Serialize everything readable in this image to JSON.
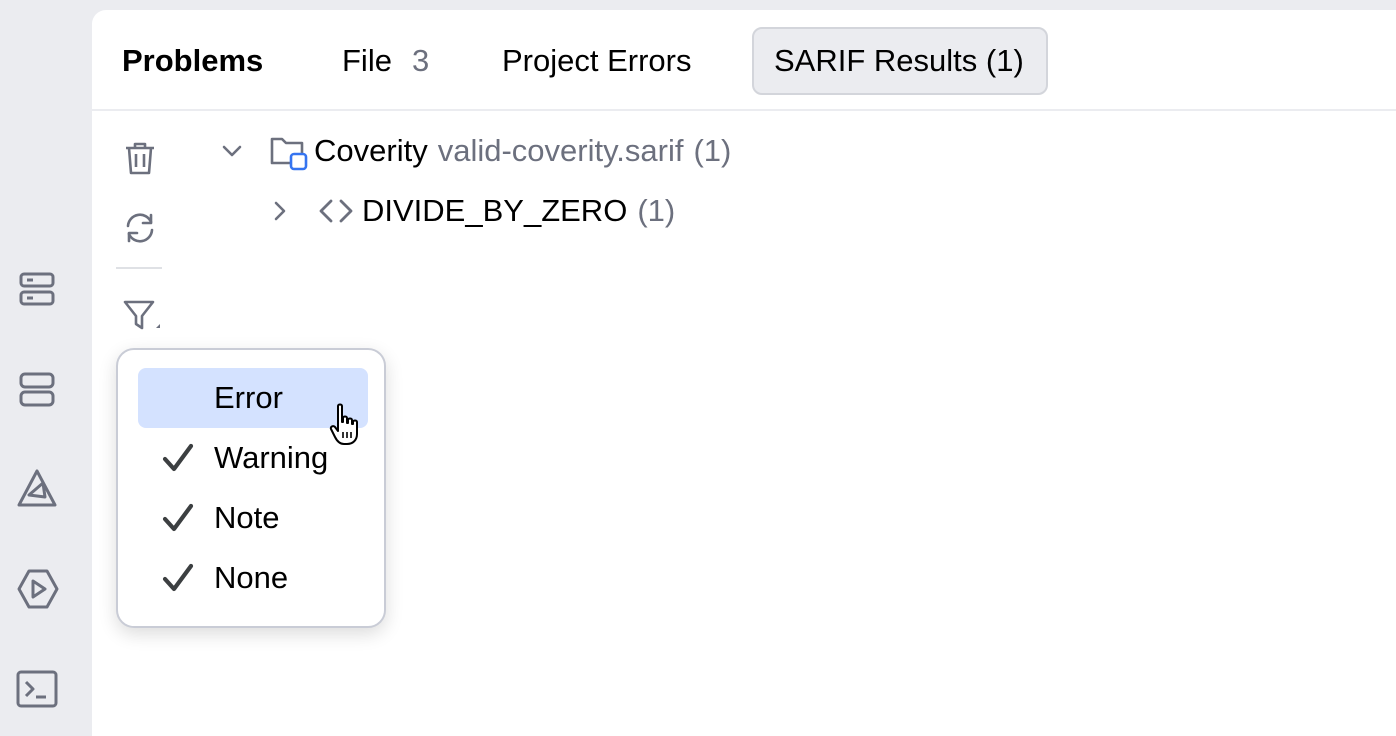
{
  "tabs": {
    "title": "Problems",
    "file_label": "File",
    "file_count": "3",
    "project_errors": "Project Errors",
    "sarif_results": "SARIF Results (1)"
  },
  "tree": {
    "root_name": "Coverity",
    "root_file": "valid-coverity.sarif",
    "root_count": "(1)",
    "child_name": "DIVIDE_BY_ZERO",
    "child_count": "(1)"
  },
  "filter_menu": {
    "items": [
      {
        "label": "Error",
        "checked": false
      },
      {
        "label": "Warning",
        "checked": true
      },
      {
        "label": "Note",
        "checked": true
      },
      {
        "label": "None",
        "checked": true
      }
    ]
  },
  "icons": {
    "strip": [
      "database-icon",
      "layout-icon",
      "deploy-icon",
      "run-icon",
      "terminal-icon"
    ],
    "toolbar": [
      "trash-icon",
      "refresh-icon",
      "filter-icon"
    ]
  },
  "colors": {
    "selection": "#d4e2ff",
    "muted_text": "#6c707e",
    "panel_bg": "#ffffff",
    "frame_bg": "#ebecf0",
    "folder_accent": "#3574f0"
  }
}
